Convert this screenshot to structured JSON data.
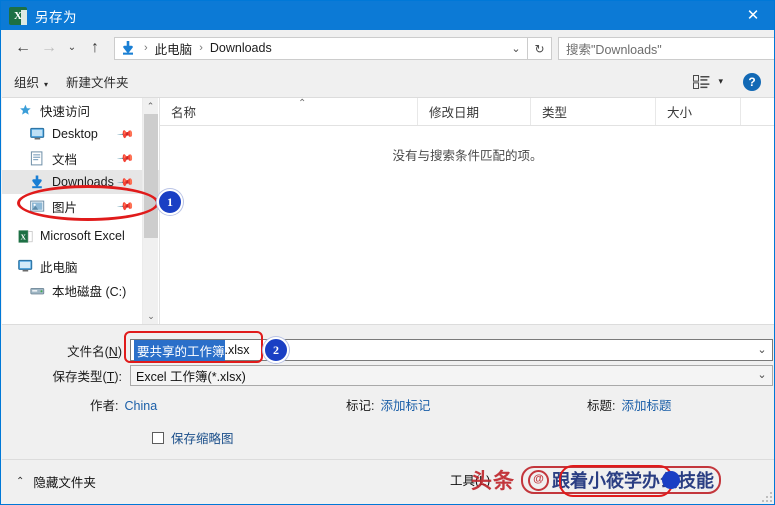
{
  "window": {
    "title": "另存为",
    "app_icon": "excel-icon",
    "close_label": "✕"
  },
  "nav": {
    "back": "←",
    "forward": "→",
    "recent": "⌄",
    "up": "↑",
    "refresh": "↻",
    "breadcrumb": [
      "此电脑",
      "Downloads"
    ],
    "breadcrumb_icon": "downloads-arrow-icon",
    "dropdown_caret": "⌄"
  },
  "search": {
    "placeholder": "搜索\"Downloads\"",
    "icon": "search-icon"
  },
  "toolbar": {
    "organize": "组织",
    "organize_caret": "▾",
    "new_folder": "新建文件夹",
    "view_icon": "view-layout-icon",
    "view_caret": "▾",
    "help": "?"
  },
  "sidebar": {
    "items": [
      {
        "label": "快速访问",
        "icon": "star-pin-icon",
        "level": "root",
        "pinned": false,
        "selected": false
      },
      {
        "label": "Desktop",
        "icon": "monitor-icon",
        "level": "child",
        "pinned": true,
        "selected": false
      },
      {
        "label": "文档",
        "icon": "document-icon",
        "level": "child",
        "pinned": true,
        "selected": false
      },
      {
        "label": "Downloads",
        "icon": "downloads-arrow-icon",
        "level": "child",
        "pinned": true,
        "selected": true
      },
      {
        "label": "图片",
        "icon": "picture-icon",
        "level": "child",
        "pinned": true,
        "selected": false
      },
      {
        "label": "Microsoft Excel",
        "icon": "excel-icon",
        "level": "root",
        "pinned": false,
        "selected": false
      },
      {
        "label": "此电脑",
        "icon": "computer-icon",
        "level": "root",
        "pinned": false,
        "selected": false
      },
      {
        "label": "本地磁盘 (C:)",
        "icon": "drive-icon",
        "level": "child",
        "pinned": false,
        "selected": false
      }
    ],
    "scroll_up": "⌃",
    "scroll_down": "⌄"
  },
  "filelist": {
    "columns": [
      "名称",
      "修改日期",
      "类型",
      "大小"
    ],
    "sort_indicator": "⌃",
    "rows": [],
    "empty_message": "没有与搜索条件匹配的项。"
  },
  "form": {
    "filename_label_pre": "文件名(",
    "filename_label_key": "N",
    "filename_label_post": ")",
    "filename_selected": "要共享的工作簿",
    "filename_extension": ".xlsx",
    "filename_caret": "⌄",
    "savetype_label_pre": "保存类型(",
    "savetype_label_key": "T",
    "savetype_label_post": "):",
    "savetype_value": "Excel 工作簿(*.xlsx)",
    "savetype_caret": "⌄",
    "meta": [
      {
        "key": "作者:",
        "value": "China"
      },
      {
        "key": "标记:",
        "value": "添加标记"
      },
      {
        "key": "标题:",
        "value": "添加标题"
      }
    ],
    "thumbnail_label": "保存缩略图",
    "thumbnail_checked": false
  },
  "footer": {
    "hide_folders": "隐藏文件夹",
    "hide_folders_chevron": "⌃",
    "tools_label": "工具(L)"
  },
  "annotations": {
    "badges": [
      {
        "text": "1"
      },
      {
        "text": "2"
      }
    ],
    "highlight_color": "#e01b1b"
  },
  "watermark": {
    "brand": "头条",
    "at_symbol": "@",
    "handle": "跟着小筱学办公技能"
  }
}
